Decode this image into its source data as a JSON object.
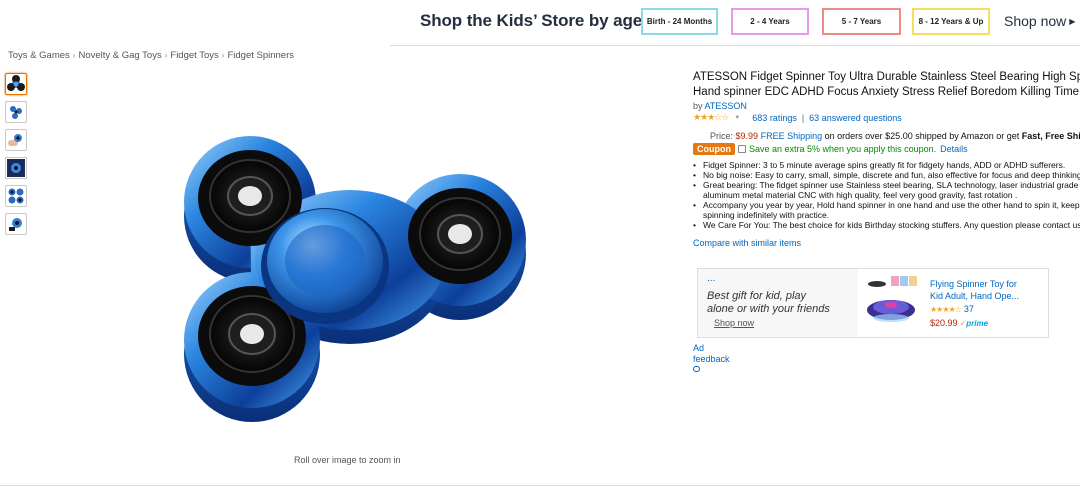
{
  "age_banner": {
    "title": "Shop the Kids’ Store by age",
    "buttons": [
      "Birth - 24 Months",
      "2 - 4 Years",
      "5 - 7 Years",
      "8 - 12 Years & Up"
    ],
    "shop_now": "Shop now"
  },
  "breadcrumb": [
    "Toys & Games",
    "Novelty & Gag Toys",
    "Fidget Toys",
    "Fidget Spinners"
  ],
  "thumbnails_count": 6,
  "image": {
    "zoom_hint": "Roll over image to zoom in"
  },
  "product": {
    "title_line1": "ATESSON Fidget Spinner Toy Ultra Durable Stainless Steel Bearing High Speed",
    "title_line2": "Hand spinner EDC ADHD Focus Anxiety Stress Relief Boredom Killing Time Toys",
    "by_prefix": "by",
    "brand": "ATESSON",
    "stars": "★★★☆☆",
    "rating_stars_value": 3.5,
    "ratings_link": "683 ratings",
    "pipe": "|",
    "questions_link": "63 answered questions",
    "price_label": "Price:",
    "price": "$9.99",
    "free_shipping": "FREE Shipping",
    "shipping_text": "on orders over $25.00 shipped by Amazon or get",
    "fast_free": "Fast, Free Shipping",
    "coupon_badge": "Coupon",
    "coupon_text": "Save an extra 5% when you apply this coupon.",
    "coupon_details": "Details",
    "bullets": [
      "Fidget Spinner: 3 to 5 minute average spins greatly fit for fidgety hands, ADD or ADHD sufferers.",
      "No big noise: Easy to carry, small, simple, discrete and fun, also effective for focus and deep thinking.",
      "Great bearing: The fidget spinner use Stainless steel bearing, SLA technology, laser industrial grade",
      "aluminum metal material CNC with high quality, feel very good gravity, fast rotation .",
      "Accompany you year by year, Hold hand spinner in one hand and use the other hand to spin it, keep",
      "spinning indefinitely with practice.",
      "We Care For You: The best choice for kids Birthday stocking stuffers. Any question please contact us."
    ],
    "compare_link": "Compare with similar items"
  },
  "ad": {
    "dots": "...",
    "slogan_line1": "Best gift for kid, play",
    "slogan_line2": "alone or with your friends",
    "shop_now": "Shop now",
    "product_line1": "Flying Spinner Toy for",
    "product_line2": "Kid Adult, Hand Ope...",
    "stars": "★★★★☆",
    "rating_count": "37",
    "price": "$20.99",
    "prime_check": "✓",
    "prime": "prime",
    "label": "Ad",
    "feedback": "feedback"
  },
  "colors": {
    "link": "#0066c0",
    "price": "#b12704",
    "coupon": "#e47911",
    "star": "#f0a41b",
    "spinner_blue": "#2a7fd4"
  }
}
